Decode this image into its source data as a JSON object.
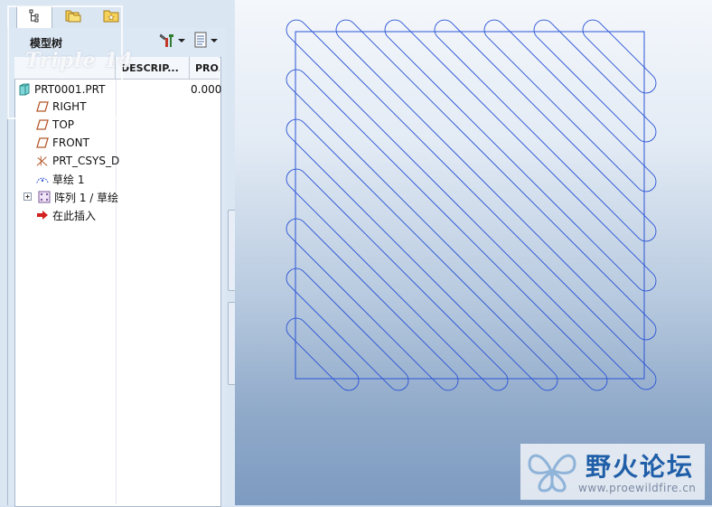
{
  "model_tree": {
    "title": "模型树",
    "columns": [
      "",
      "DESCRIP...",
      "PRO..."
    ],
    "items": [
      {
        "label": "PRT0001.PRT",
        "value": "0.000",
        "icon": "part-icon"
      },
      {
        "label": "RIGHT",
        "icon": "datum-plane-icon"
      },
      {
        "label": "TOP",
        "icon": "datum-plane-icon"
      },
      {
        "label": "FRONT",
        "icon": "datum-plane-icon"
      },
      {
        "label": "PRT_CSYS_D",
        "icon": "coordinate-system-icon"
      },
      {
        "label": "草绘 1",
        "icon": "sketch-icon"
      },
      {
        "label": "阵列 1 / 草绘",
        "icon": "pattern-icon"
      },
      {
        "label": "在此插入",
        "icon": "insert-here-arrow-icon"
      }
    ]
  },
  "tabs": [
    {
      "name": "model-tree-tab",
      "icon": "tree-icon"
    },
    {
      "name": "folder-browser-tab",
      "icon": "folders-icon"
    },
    {
      "name": "favorites-tab",
      "icon": "favorites-folder-icon"
    }
  ],
  "watermark": {
    "text": "Triple 14"
  },
  "logo": {
    "cn": "野火论坛",
    "url": "www.proewildfire.cn"
  },
  "colors": {
    "sketch_line": "#2b54d6",
    "accent": "#1f5ea8"
  }
}
